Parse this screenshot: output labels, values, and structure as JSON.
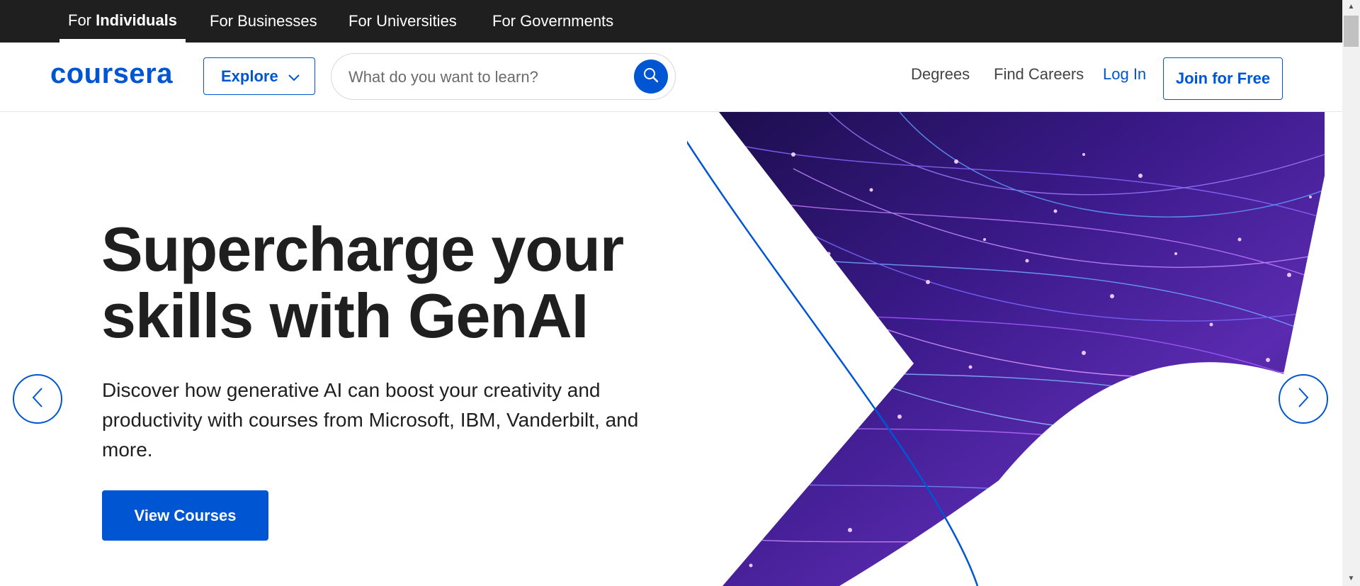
{
  "top_tabs": [
    {
      "prefix": "For ",
      "bold": "Individuals",
      "active": true
    },
    {
      "label": "For Businesses"
    },
    {
      "label": "For Universities"
    },
    {
      "label": "For Governments"
    }
  ],
  "header": {
    "logo": "coursera",
    "explore_label": "Explore",
    "search_placeholder": "What do you want to learn?",
    "nav": {
      "degrees": "Degrees",
      "find_careers": "Find Careers",
      "log_in": "Log In",
      "join": "Join for Free"
    }
  },
  "hero": {
    "title_line1": "Supercharge your",
    "title_line2": "skills with GenAI",
    "subtitle": "Discover how generative AI can boost your creativity and productivity with courses from Microsoft, IBM, Vanderbilt, and more.",
    "cta": "View Courses"
  },
  "colors": {
    "brand": "#0056d2",
    "topbar": "#1f1f1f",
    "text": "#1f1f1f"
  },
  "icons": [
    "chevron-down-icon",
    "search-icon",
    "chevron-left-icon",
    "chevron-right-icon"
  ]
}
